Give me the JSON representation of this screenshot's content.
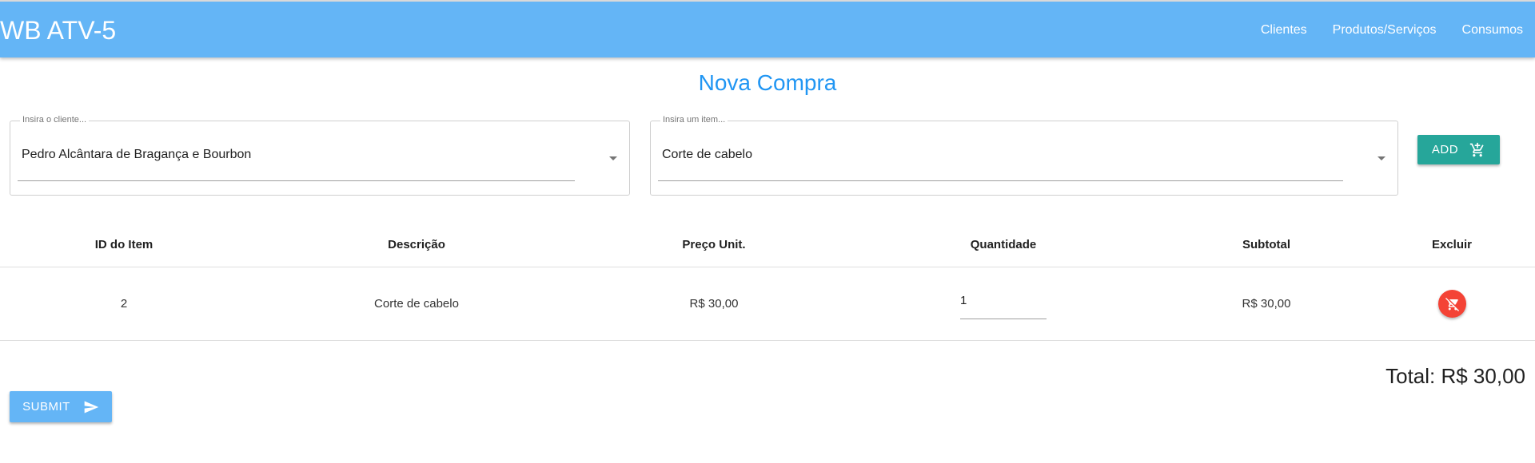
{
  "navbar": {
    "brand": "WB ATV-5",
    "links": [
      "Clientes",
      "Produtos/Serviços",
      "Consumos"
    ]
  },
  "page": {
    "title": "Nova Compra"
  },
  "client_select": {
    "label": "Insira o cliente...",
    "value": "Pedro Alcântara de Bragança e Bourbon"
  },
  "item_select": {
    "label": "Insira um item...",
    "value": "Corte de cabelo"
  },
  "add_button": {
    "label": "ADD",
    "icon": "add-shopping-cart-icon"
  },
  "table": {
    "headers": [
      "ID do Item",
      "Descrição",
      "Preço Unit.",
      "Quantidade",
      "Subtotal",
      "Excluir"
    ],
    "rows": [
      {
        "id": "2",
        "descricao": "Corte de cabelo",
        "preco": "R$ 30,00",
        "quantidade": "1",
        "subtotal": "R$ 30,00",
        "delete_icon": "remove-shopping-cart-icon"
      }
    ]
  },
  "total": "Total: R$ 30,00",
  "submit_button": {
    "label": "SUBMIT",
    "icon": "send-icon"
  },
  "colors": {
    "navbar": "#64b5f6",
    "title": "#2196f3",
    "add_button": "#26a69a",
    "delete_button": "#f44336",
    "submit_button": "#64b5f6"
  }
}
